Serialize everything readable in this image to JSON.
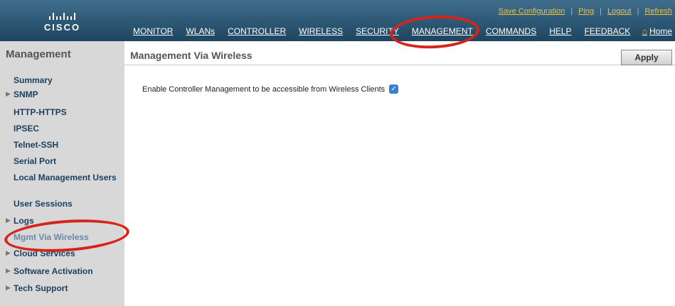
{
  "brand": {
    "logo_text": "CISCO"
  },
  "util_links": [
    "Save Configuration",
    "Ping",
    "Logout",
    "Refresh"
  ],
  "nav": [
    "MONITOR",
    "WLANs",
    "CONTROLLER",
    "WIRELESS",
    "SECURITY",
    "MANAGEMENT",
    "COMMANDS",
    "HELP",
    "FEEDBACK"
  ],
  "home_label": "Home",
  "sidebar": {
    "title": "Management",
    "items": [
      {
        "label": "Summary",
        "arrow": false
      },
      {
        "label": "SNMP",
        "arrow": true
      },
      {
        "label": "HTTP-HTTPS",
        "arrow": false
      },
      {
        "label": "IPSEC",
        "arrow": false
      },
      {
        "label": "Telnet-SSH",
        "arrow": false
      },
      {
        "label": "Serial Port",
        "arrow": false
      },
      {
        "label": "Local Management Users",
        "arrow": false
      },
      {
        "label": "User Sessions",
        "arrow": false
      },
      {
        "label": "Logs",
        "arrow": true
      },
      {
        "label": "Mgmt Via Wireless",
        "arrow": false
      },
      {
        "label": "Cloud Services",
        "arrow": true
      },
      {
        "label": "Software Activation",
        "arrow": true
      },
      {
        "label": "Tech Support",
        "arrow": true
      }
    ]
  },
  "main": {
    "title": "Management Via Wireless",
    "apply_label": "Apply",
    "setting_label": "Enable Controller Management to be accessible from Wireless Clients",
    "setting_checked": true
  }
}
